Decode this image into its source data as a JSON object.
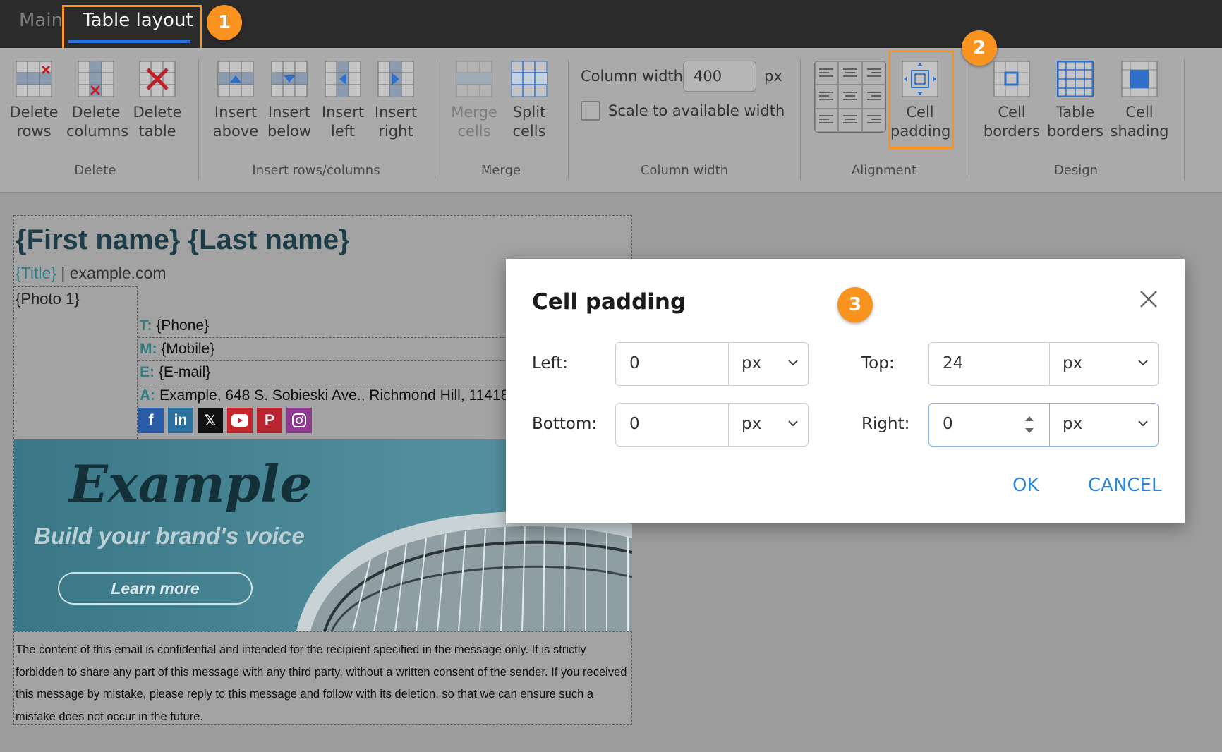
{
  "tabs": {
    "main": "Main",
    "table_layout": "Table layout"
  },
  "badges": [
    "1",
    "2",
    "3"
  ],
  "ribbon": {
    "groups": {
      "delete": {
        "label": "Delete",
        "items": [
          "Delete\nrows",
          "Delete\ncolumns",
          "Delete\ntable"
        ]
      },
      "insert": {
        "label": "Insert rows/columns",
        "items": [
          "Insert\nabove",
          "Insert\nbelow",
          "Insert\nleft",
          "Insert\nright"
        ]
      },
      "merge": {
        "label": "Merge",
        "items": [
          "Merge\ncells",
          "Split\ncells"
        ]
      },
      "column_width": {
        "label": "Column width",
        "field_label": "Column width:",
        "value": "400",
        "unit": "px",
        "scale_label": "Scale to available width"
      },
      "alignment": {
        "label": "Alignment",
        "cell_padding": "Cell\npadding"
      },
      "design": {
        "label": "Design",
        "items": [
          "Cell\nborders",
          "Table\nborders",
          "Cell\nshading"
        ]
      }
    }
  },
  "signature": {
    "name": "{First name} {Last name}",
    "title": "{Title}",
    "separator": " | ",
    "website": "example.com",
    "photo": "{Photo 1}",
    "rows": [
      {
        "key": "T:",
        "value": " {Phone}"
      },
      {
        "key": "M:",
        "value": " {Mobile}"
      },
      {
        "key": "E:",
        "value": " {E-mail}"
      },
      {
        "key": "A:",
        "value": " Example, 648 S. Sobieski Ave., Richmond Hill, 11418"
      }
    ],
    "banner": {
      "logo": "Example",
      "tagline": "Build your brand's voice",
      "button": "Learn more"
    },
    "disclaimer": "The content of this email is confidential and intended for the recipient specified in the message only. It is strictly forbidden to share any part of this message with any third party, without a written consent of the sender. If you received this message by mistake, please reply to this message and follow with its deletion, so that we can ensure such a mistake does not occur in the future."
  },
  "dialog": {
    "title": "Cell padding",
    "left_label": "Left:",
    "left_value": "0",
    "left_unit": "px",
    "top_label": "Top:",
    "top_value": "24",
    "top_unit": "px",
    "bottom_label": "Bottom:",
    "bottom_value": "0",
    "bottom_unit": "px",
    "right_label": "Right:",
    "right_value": "0",
    "right_unit": "px",
    "ok": "OK",
    "cancel": "CANCEL"
  },
  "colors": {
    "highlight": "#f7931e",
    "accent": "#2d86d9",
    "teal": "#2e7f86"
  }
}
